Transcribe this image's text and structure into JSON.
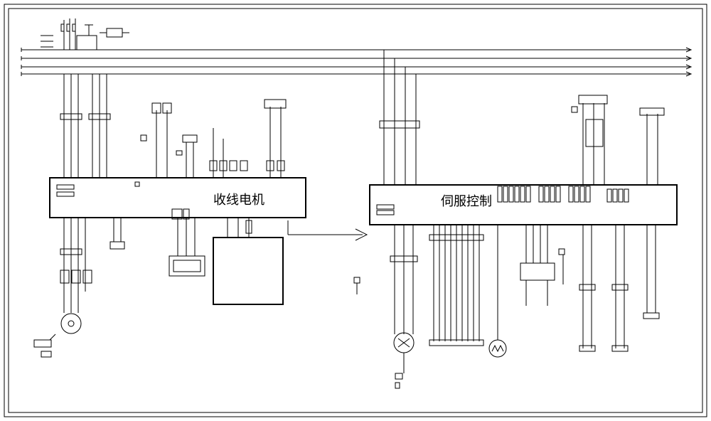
{
  "labels": {
    "left_block": "收线电机",
    "right_block": "伺服控制"
  }
}
